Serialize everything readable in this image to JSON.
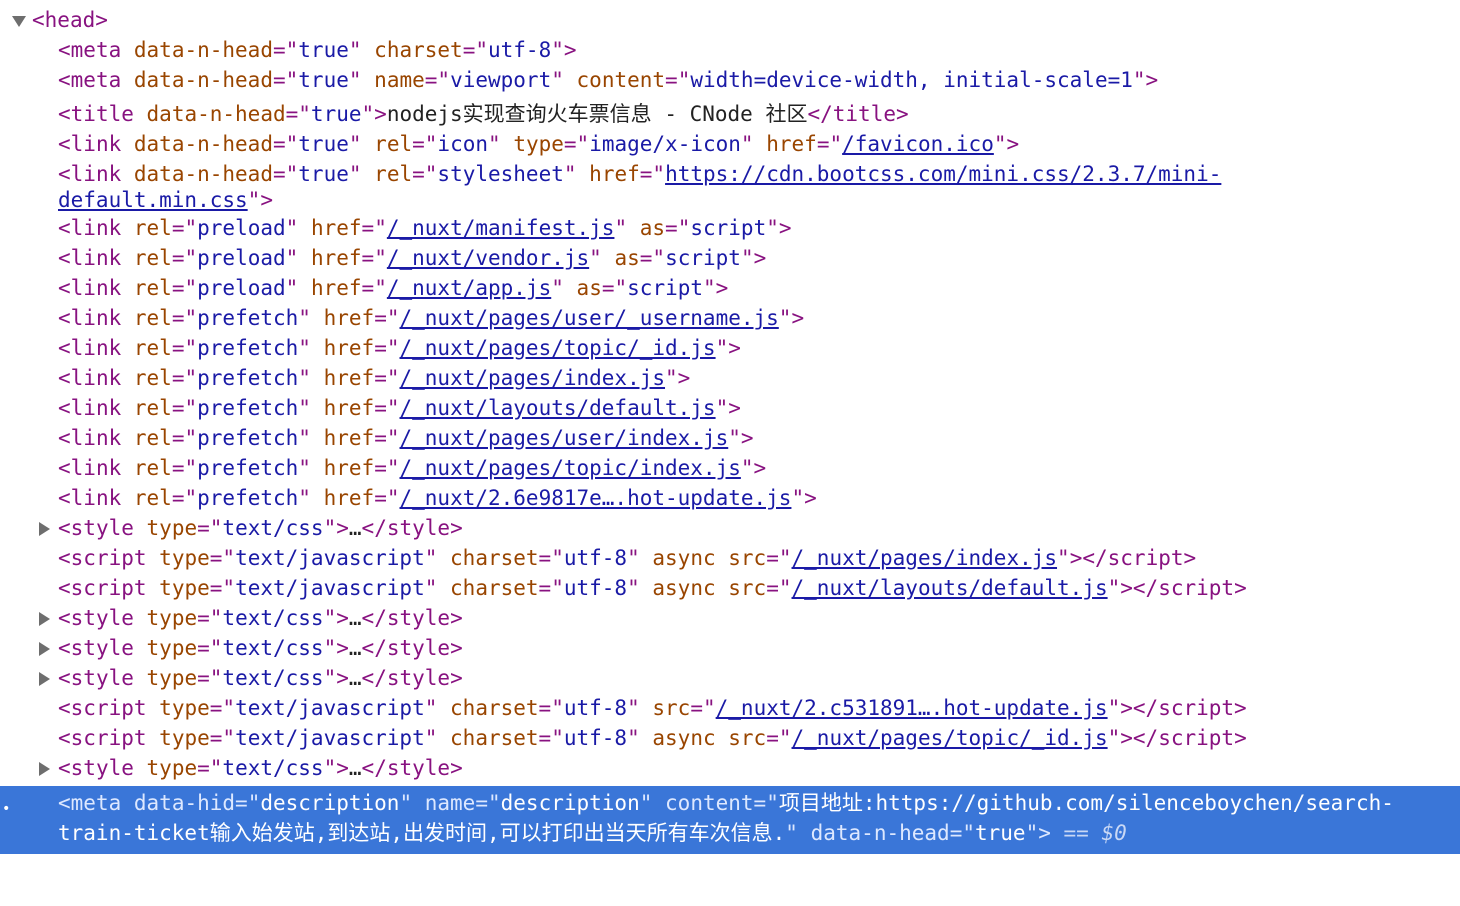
{
  "root_open": "<",
  "root_tag": "head",
  "root_close": ">",
  "q": "\"",
  "eq": "=",
  "lt": "<",
  "gt": ">",
  "lts": "</",
  "ellipsis": "…",
  "tags": {
    "meta": "meta",
    "title": "title",
    "link": "link",
    "style": "style",
    "script": "script"
  },
  "attrs": {
    "data_n_head": "data-n-head",
    "charset": "charset",
    "name": "name",
    "content": "content",
    "rel": "rel",
    "type": "type",
    "href": "href",
    "as": "as",
    "async": "async",
    "src": "src",
    "data_hid": "data-hid"
  },
  "vals": {
    "true": "true",
    "utf8": "utf-8",
    "viewport": "viewport",
    "viewport_content": "width=device-width, initial-scale=1",
    "icon": "icon",
    "image_x_icon": "image/x-icon",
    "stylesheet": "stylesheet",
    "preload": "preload",
    "prefetch": "prefetch",
    "script": "script",
    "text_css": "text/css",
    "text_js": "text/javascript",
    "description": "description"
  },
  "title_text": "nodejs实现查询火车票信息 - CNode 社区",
  "links": {
    "favicon": "/favicon.ico",
    "mini_css_1": "https://cdn.bootcss.com/mini.css/2.3.7/mini-",
    "mini_css_2": "default.min.css",
    "manifest": "/_nuxt/manifest.js",
    "vendor": "/_nuxt/vendor.js",
    "app": "/_nuxt/app.js",
    "user_username": "/_nuxt/pages/user/_username.js",
    "topic_id": "/_nuxt/pages/topic/_id.js",
    "pages_index": "/_nuxt/pages/index.js",
    "layouts_default": "/_nuxt/layouts/default.js",
    "user_index": "/_nuxt/pages/user/index.js",
    "topic_index": "/_nuxt/pages/topic/index.js",
    "hot_update_1": "/_nuxt/2.6e9817e….hot-update.js",
    "hot_update_2": "/_nuxt/2.c531891….hot-update.js"
  },
  "selected": {
    "content_1": "项目地址:https://github.com/silenceboychen/search-",
    "content_2": "train-ticket输入始发站,到达站,出发时间,可以打印出当天所有车次信息.",
    "eq_marker": " == ",
    "dollar": "$0"
  }
}
